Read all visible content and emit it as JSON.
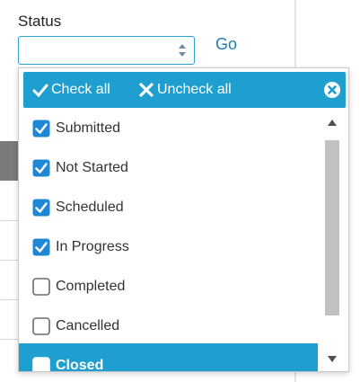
{
  "filter": {
    "label": "Status",
    "select_value": "",
    "go_label": "Go"
  },
  "dropdown": {
    "check_all_label": "Check all",
    "uncheck_all_label": "Uncheck all",
    "options": [
      {
        "label": "Submitted",
        "checked": true
      },
      {
        "label": "Not Started",
        "checked": true
      },
      {
        "label": "Scheduled",
        "checked": true
      },
      {
        "label": "In Progress",
        "checked": true
      },
      {
        "label": "Completed",
        "checked": false
      },
      {
        "label": "Cancelled",
        "checked": false
      },
      {
        "label": "Closed",
        "checked": false,
        "highlighted": true
      }
    ]
  },
  "colors": {
    "accent": "#1e9fcf",
    "checkbox_checked": "#1e88d6",
    "link": "#1f7fb3"
  },
  "icons": [
    "sort-arrows-icon",
    "checkmark-icon",
    "x-mark-icon",
    "close-circle-icon",
    "scroll-up-arrow-icon",
    "scroll-down-arrow-icon"
  ]
}
